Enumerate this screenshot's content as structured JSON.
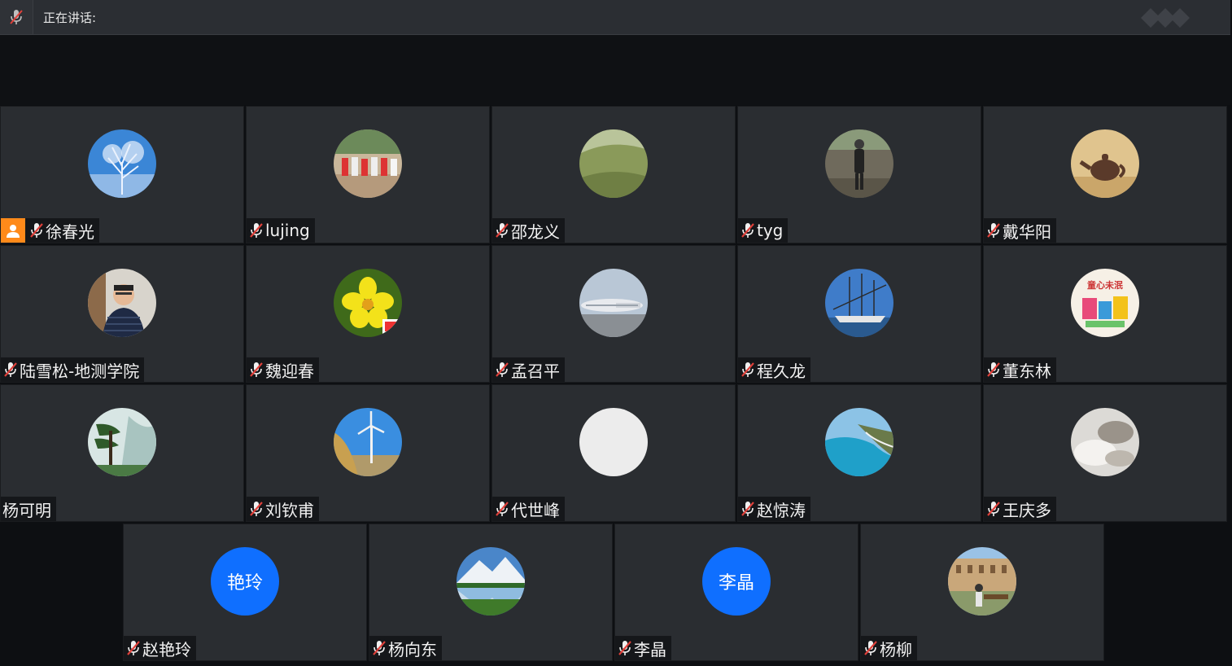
{
  "topbar": {
    "speaking_label": "正在讲话:"
  },
  "participants": [
    {
      "name": "徐春光",
      "muted": true,
      "host": true,
      "avatar": "winter-tree"
    },
    {
      "name": "lujing",
      "muted": true,
      "avatar": "children-group"
    },
    {
      "name": "邵龙义",
      "muted": true,
      "avatar": "grass-hill"
    },
    {
      "name": "tyg",
      "muted": true,
      "avatar": "person-standing"
    },
    {
      "name": "戴华阳",
      "muted": true,
      "avatar": "teapot"
    },
    {
      "name": "陆雪松-地测学院",
      "muted": true,
      "avatar": "man-portrait"
    },
    {
      "name": "魏迎春",
      "muted": true,
      "avatar": "yellow-flower"
    },
    {
      "name": "孟召平",
      "muted": true,
      "avatar": "airplane"
    },
    {
      "name": "程久龙",
      "muted": true,
      "avatar": "sailing-ship"
    },
    {
      "name": "董东林",
      "muted": true,
      "avatar": "colorful-sign",
      "avatar_text": "童心未泯"
    },
    {
      "name": "杨可明",
      "muted": false,
      "avatar": "pine-mountain"
    },
    {
      "name": "刘钦甫",
      "muted": true,
      "avatar": "wind-turbine"
    },
    {
      "name": "代世峰",
      "muted": true,
      "avatar": "blank"
    },
    {
      "name": "赵惊涛",
      "muted": true,
      "avatar": "coastline"
    },
    {
      "name": "王庆多",
      "muted": true,
      "avatar": "white-abstract"
    },
    {
      "name": "赵艳玲",
      "muted": true,
      "avatar": "text",
      "avatar_text": "艳玲"
    },
    {
      "name": "杨向东",
      "muted": true,
      "avatar": "snow-mountain-lake"
    },
    {
      "name": "李晶",
      "muted": true,
      "avatar": "text",
      "avatar_text": "李晶"
    },
    {
      "name": "杨柳",
      "muted": true,
      "avatar": "campus-bench"
    }
  ],
  "colors": {
    "tile_bg": "#2a2d31",
    "text_avatar_bg": "#0f6fff",
    "host_badge": "#ff8a1a",
    "mute_slash": "#e0403a"
  }
}
